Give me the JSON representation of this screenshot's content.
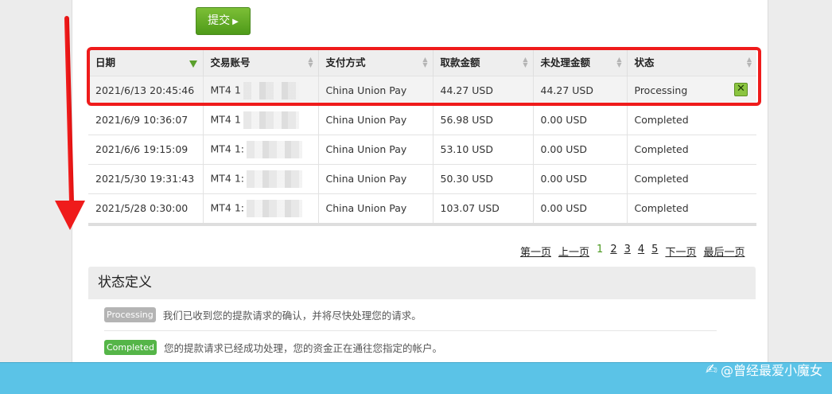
{
  "submit_label": "提交",
  "table": {
    "headers": [
      "日期",
      "交易账号",
      "支付方式",
      "取款金额",
      "未处理金额",
      "状态"
    ],
    "rows": [
      {
        "date": "2021/6/13 20:45:46",
        "account": "MT4 1",
        "method": "China Union Pay",
        "amount": "44.27 USD",
        "pending": "44.27 USD",
        "status": "Processing"
      },
      {
        "date": "2021/6/9 10:36:07",
        "account": "MT4 1",
        "method": "China Union Pay",
        "amount": "56.98 USD",
        "pending": "0.00 USD",
        "status": "Completed"
      },
      {
        "date": "2021/6/6 19:15:09",
        "account": "MT4 1:",
        "method": "China Union Pay",
        "amount": "53.10 USD",
        "pending": "0.00 USD",
        "status": "Completed"
      },
      {
        "date": "2021/5/30 19:31:43",
        "account": "MT4 1:",
        "method": "China Union Pay",
        "amount": "50.30 USD",
        "pending": "0.00 USD",
        "status": "Completed"
      },
      {
        "date": "2021/5/28 0:30:00",
        "account": "MT4 1:",
        "method": "China Union Pay",
        "amount": "103.07 USD",
        "pending": "0.00 USD",
        "status": "Completed"
      }
    ]
  },
  "pager": {
    "first": "第一页",
    "prev": "上一页",
    "pages": [
      "1",
      "2",
      "3",
      "4",
      "5"
    ],
    "next": "下一页",
    "last": "最后一页"
  },
  "definitions": {
    "title": "状态定义",
    "items": [
      {
        "badge": "Processing",
        "text": "我们已收到您的提款请求的确认，并将尽快处理您的请求。"
      },
      {
        "badge": "Completed",
        "text": "您的提款请求已经成功处理，您的资金正在通往您指定的帐户。"
      }
    ]
  },
  "watermark": "@曾经最爱小魔女",
  "colors": {
    "accent_green": "#5aa02c",
    "highlight_red": "#ef1b1b",
    "footer_blue": "#5bc3e7"
  },
  "icons": {
    "cancel": "close-icon",
    "sort": "sort-icon",
    "annotation_arrow": "arrow-down-icon"
  }
}
